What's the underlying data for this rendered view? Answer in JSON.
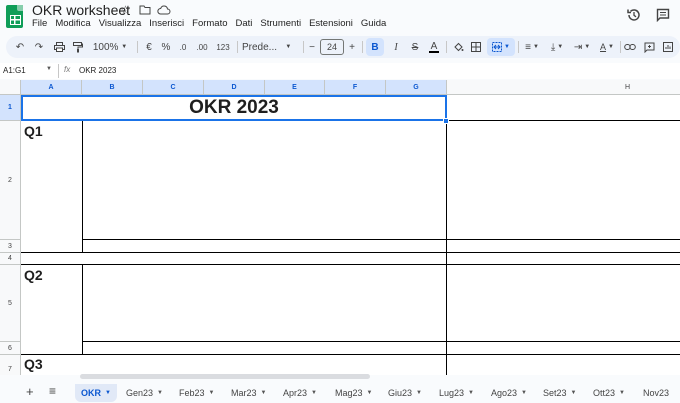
{
  "app": {
    "title": "OKR worksheet",
    "menus": [
      "File",
      "Modifica",
      "Visualizza",
      "Inserisci",
      "Formato",
      "Dati",
      "Strumenti",
      "Estensioni",
      "Guida"
    ]
  },
  "toolbar": {
    "zoom": "100%",
    "currency": "€",
    "percent": "%",
    "dec_less": ".0",
    "dec_more": ".00",
    "number_format": "123",
    "font": "Prede...",
    "font_size": "24",
    "bold": "B",
    "italic": "I",
    "strike": "S",
    "text_color": "A"
  },
  "formula_bar": {
    "name_box": "A1:G1",
    "fx": "fx",
    "value": "OKR 2023"
  },
  "grid": {
    "columns": [
      "A",
      "B",
      "C",
      "D",
      "E",
      "F",
      "G",
      "H"
    ],
    "rows": [
      "1",
      "2",
      "3",
      "4",
      "5",
      "6",
      "7"
    ],
    "title": "OKR 2023",
    "quarters": [
      "Q1",
      "Q2",
      "Q3"
    ]
  },
  "sheets": {
    "add": "+",
    "list": "≡",
    "tabs": [
      "OKR",
      "Gen23",
      "Feb23",
      "Mar23",
      "Apr23",
      "Mag23",
      "Giu23",
      "Lug23",
      "Ago23",
      "Set23",
      "Ott23",
      "Nov23"
    ],
    "active": "OKR"
  },
  "colors": {
    "accent": "#1a73e8",
    "logo": "#0f9d58",
    "toolbar_bg": "#edf2fa"
  }
}
